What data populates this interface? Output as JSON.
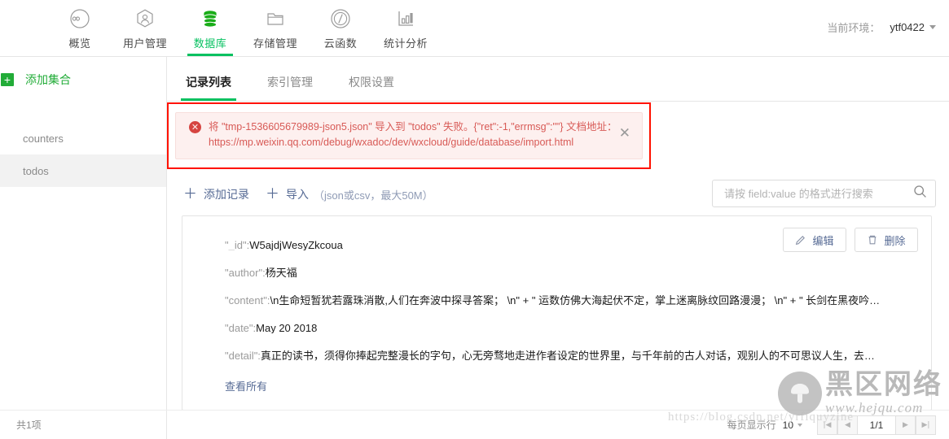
{
  "topnav": {
    "items": [
      {
        "label": "概览",
        "icon": "infinity-icon",
        "active": false
      },
      {
        "label": "用户管理",
        "icon": "user-hexagon-icon",
        "active": false
      },
      {
        "label": "数据库",
        "icon": "database-icon",
        "active": true
      },
      {
        "label": "存储管理",
        "icon": "folder-icon",
        "active": false
      },
      {
        "label": "云函数",
        "icon": "slash-circle-icon",
        "active": false
      },
      {
        "label": "统计分析",
        "icon": "bar-chart-icon",
        "active": false
      }
    ],
    "env_label": "当前环境：",
    "env_value": "ytf0422"
  },
  "sidebar": {
    "add_collection": "添加集合",
    "collections": [
      {
        "label": "counters",
        "selected": false
      },
      {
        "label": "todos",
        "selected": true
      }
    ]
  },
  "tabs": [
    {
      "label": "记录列表",
      "active": true
    },
    {
      "label": "索引管理",
      "active": false
    },
    {
      "label": "权限设置",
      "active": false
    }
  ],
  "alert": {
    "icon": "error-circle-icon",
    "line1": "将 \"tmp-1536605679989-json5.json\" 导入到 \"todos\" 失败。{\"ret\":-1,\"errmsg\":\"\"} 文档地址：",
    "line2": "https://mp.weixin.qq.com/debug/wxadoc/dev/wxcloud/guide/database/import.html",
    "close": "✕"
  },
  "toolbar": {
    "add_record": "添加记录",
    "import": "导入",
    "import_hint": "（json或csv，最大50M）",
    "plus": "＋"
  },
  "search": {
    "placeholder": "请按 field:value 的格式进行搜索",
    "value": "",
    "icon": "search-icon"
  },
  "record": {
    "edit_label": "编辑",
    "delete_label": "删除",
    "view_all": "查看所有",
    "fields": [
      {
        "key": "\"_id\":",
        "value": "W5ajdjWesyZkcoua"
      },
      {
        "key": "\"author\":",
        "value": "杨天福"
      },
      {
        "key": "\"content\":",
        "value": "\\n生命短暂犹若露珠消散,人们在奔波中探寻答案； \\n\" + \" 运数仿佛大海起伏不定，掌上迷离脉纹回路漫漫； \\n\" + \" 长剑在黑夜吟…"
      },
      {
        "key": "\"date\":",
        "value": "May 20 2018"
      },
      {
        "key": "\"detail\":",
        "value": "真正的读书，须得你捧起完整漫长的字句，心无旁骛地走进作者设定的世界里，与千年前的古人对话，观别人的不可思议人生，去…"
      }
    ]
  },
  "footer": {
    "total": "共1项",
    "perpage_label": "每页显示行",
    "perpage_value": "10",
    "page_indicator": "1/1",
    "first_page": "|◀",
    "prev_page": "◀",
    "next_page": "▶",
    "last_page": "▶|"
  },
  "watermark": {
    "url_faint": "https://blog.csdn.net/yrfiquyzine",
    "brand_cn": "黑区网络",
    "brand_en": "www.hejqu.com"
  },
  "colors": {
    "accent_green": "#07c160",
    "link_blue": "#576b95",
    "error_red": "#d64541",
    "highlight_border": "#ff1200"
  }
}
